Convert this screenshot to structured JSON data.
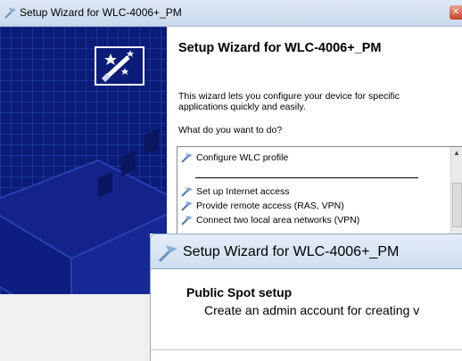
{
  "back_window": {
    "title": "Setup Wizard for WLC-4006+_PM",
    "heading": "Setup Wizard for WLC-4006+_PM",
    "description": "This wizard lets you configure your device for specific applications quickly and easily.",
    "question": "What do you want to do?",
    "options": [
      "Configure WLC profile",
      "Set up Internet access",
      "Provide remote access (RAS, VPN)",
      "Connect two local area networks (VPN)"
    ],
    "close_label": "✕"
  },
  "front_window": {
    "title": "Setup Wizard for WLC-4006+_PM",
    "heading": "Public Spot setup",
    "subtitle": "Create an admin account for creating v"
  }
}
